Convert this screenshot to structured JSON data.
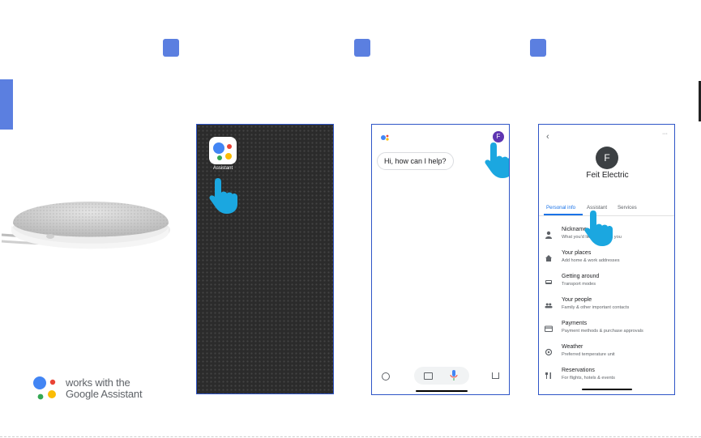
{
  "colors": {
    "accent": "#5b7fe0",
    "frame_border": "#2f55c7",
    "google_blue": "#4285f4",
    "google_red": "#ea4335",
    "google_yellow": "#fbbc05",
    "google_green": "#34a853",
    "hand": "#1ba7e0",
    "avatar_purple": "#5e35b1"
  },
  "product": {
    "image": "google-nest-mini-speaker"
  },
  "logo": {
    "line1": "works with the",
    "line2": "Google Assistant"
  },
  "screen1": {
    "app_label": "Assistant"
  },
  "screen2": {
    "greeting": "Hi, how can I help?",
    "avatar_letter": "F"
  },
  "screen3": {
    "more": "···",
    "avatar_letter": "F",
    "name": "Feit Electric",
    "tabs": [
      "Personal info",
      "Assistant",
      "Services"
    ],
    "items": [
      {
        "icon": "person-icon",
        "title": "Nickname",
        "subtitle": "What you'd like me to call you"
      },
      {
        "icon": "home-icon",
        "title": "Your places",
        "subtitle": "Add home & work addresses"
      },
      {
        "icon": "car-icon",
        "title": "Getting around",
        "subtitle": "Transport modes"
      },
      {
        "icon": "people-icon",
        "title": "Your people",
        "subtitle": "Family & other important contacts"
      },
      {
        "icon": "card-icon",
        "title": "Payments",
        "subtitle": "Payment methods & purchase approvals"
      },
      {
        "icon": "weather-icon",
        "title": "Weather",
        "subtitle": "Preferred temperature unit"
      },
      {
        "icon": "restaurant-icon",
        "title": "Reservations",
        "subtitle": "For flights, hotels & events"
      }
    ]
  }
}
